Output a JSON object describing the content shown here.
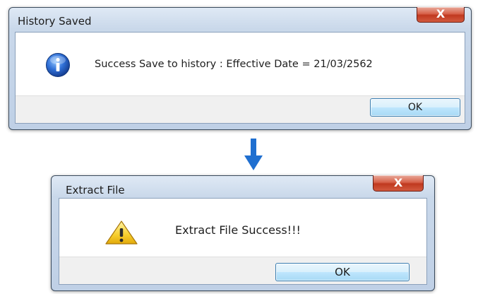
{
  "dialogs": [
    {
      "title": "History Saved",
      "close_label": "X",
      "icon": "info-icon",
      "message": "Success Save to history : Effective Date = 21/03/2562",
      "button_label": "OK"
    },
    {
      "title": "Extract File",
      "close_label": "X",
      "icon": "warning-icon",
      "message": "Extract File Success!!!",
      "button_label": "OK"
    }
  ],
  "colors": {
    "arrow": "#1f6fd0",
    "close_button": "#c9452b",
    "ok_button": "#bee6fd",
    "frame": "#c9d8ea"
  },
  "connector_icon": "down-arrow-icon"
}
